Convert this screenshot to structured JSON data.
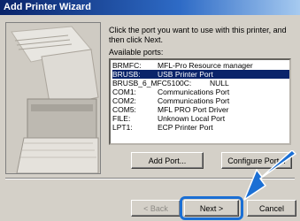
{
  "window": {
    "title": "Add Printer Wizard"
  },
  "content": {
    "instruction": "Click the port you want to use with this printer, and then click Next.",
    "available_ports_label": "Available ports:",
    "ports": [
      {
        "name": "BRMFC:",
        "desc": "MFL-Pro Resource manager",
        "selected": false
      },
      {
        "name": "BRUSB:",
        "desc": "USB Printer Port",
        "selected": true
      },
      {
        "name": "BRUSB_6_MFC5100C:",
        "desc": "NULL",
        "selected": false
      },
      {
        "name": "COM1:",
        "desc": "Communications Port",
        "selected": false
      },
      {
        "name": "COM2:",
        "desc": "Communications Port",
        "selected": false
      },
      {
        "name": "COM5:",
        "desc": "MFL PRO Port Driver",
        "selected": false
      },
      {
        "name": "FILE:",
        "desc": "Unknown Local Port",
        "selected": false
      },
      {
        "name": "LPT1:",
        "desc": "ECP Printer Port",
        "selected": false
      }
    ],
    "add_port_label": "Add Port...",
    "configure_port_label": "Configure Port..."
  },
  "footer": {
    "back_label": "< Back",
    "next_label": "Next >",
    "cancel_label": "Cancel"
  },
  "colors": {
    "selection": "#0a246a",
    "highlight": "#1b6fd4"
  }
}
